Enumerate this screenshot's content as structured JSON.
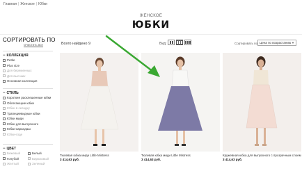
{
  "breadcrumb": [
    "Главная",
    "Женское",
    "Юбки"
  ],
  "header": {
    "subtitle": "ЖЕНСКОЕ",
    "title": "ЮБКИ"
  },
  "sidebar": {
    "sort_title": "СОРТИРОВАТЬ ПО",
    "clear_all": "Очистить все",
    "sections": [
      {
        "title": "КОЛЛЕКЦИЯ",
        "items": [
          {
            "label": "Petite",
            "dim": false
          },
          {
            "label": "Plus size",
            "dim": false
          },
          {
            "label": "Для беременных",
            "dim": true
          },
          {
            "label": "Для высоких",
            "dim": true
          },
          {
            "label": "Основная коллекция",
            "dim": false
          }
        ]
      },
      {
        "title": "СТИЛЬ",
        "items": [
          {
            "label": "Короткие расклешенные юбки",
            "dim": false
          },
          {
            "label": "Облегающие юбки",
            "dim": false
          },
          {
            "label": "Юбки в складку",
            "dim": true
          },
          {
            "label": "Трапециевидные юбки",
            "dim": false
          },
          {
            "label": "Юбки миди",
            "dim": false
          },
          {
            "label": "Юбки для выпускного",
            "dim": false
          },
          {
            "label": "Юбки-карандаш",
            "dim": false
          },
          {
            "label": "Юбки-годе",
            "dim": true
          }
        ]
      },
      {
        "title": "ЦВЕТ",
        "items": [
          {
            "label": "Бежевый",
            "dim": true
          },
          {
            "label": "Белый",
            "dim": false
          },
          {
            "label": "Голубой",
            "dim": false
          },
          {
            "label": "Бирюзовый",
            "dim": true
          },
          {
            "label": "Желтый",
            "dim": true
          },
          {
            "label": "Зеленый",
            "dim": true
          }
        ]
      }
    ]
  },
  "toolbar": {
    "items_count": "Всего найдено 9",
    "view_label": "Вид:",
    "sort_label": "Сортировать по:",
    "sort_value": "Цена по возрастанию"
  },
  "products": [
    {
      "name": "Тюлевая юбка миди Little Mistress",
      "price": "3 414,63 руб.",
      "skirt_color": "#f4f2ee",
      "top_color": "#e8c9b8"
    },
    {
      "name": "Тюлевая юбка миди Little Mistress",
      "price": "3 414,63 руб.",
      "skirt_color": "#7d7aa6",
      "top_color": "#f8f8f6"
    },
    {
      "name": "Кружевная юбка для выпускного с прозрачным слоем из сетки ASOS",
      "price": "3 414,63 руб.",
      "skirt_color": "#f3dcd3",
      "top_color": "#f0e6d6"
    }
  ],
  "colors": {
    "arrow": "#3aa832"
  }
}
